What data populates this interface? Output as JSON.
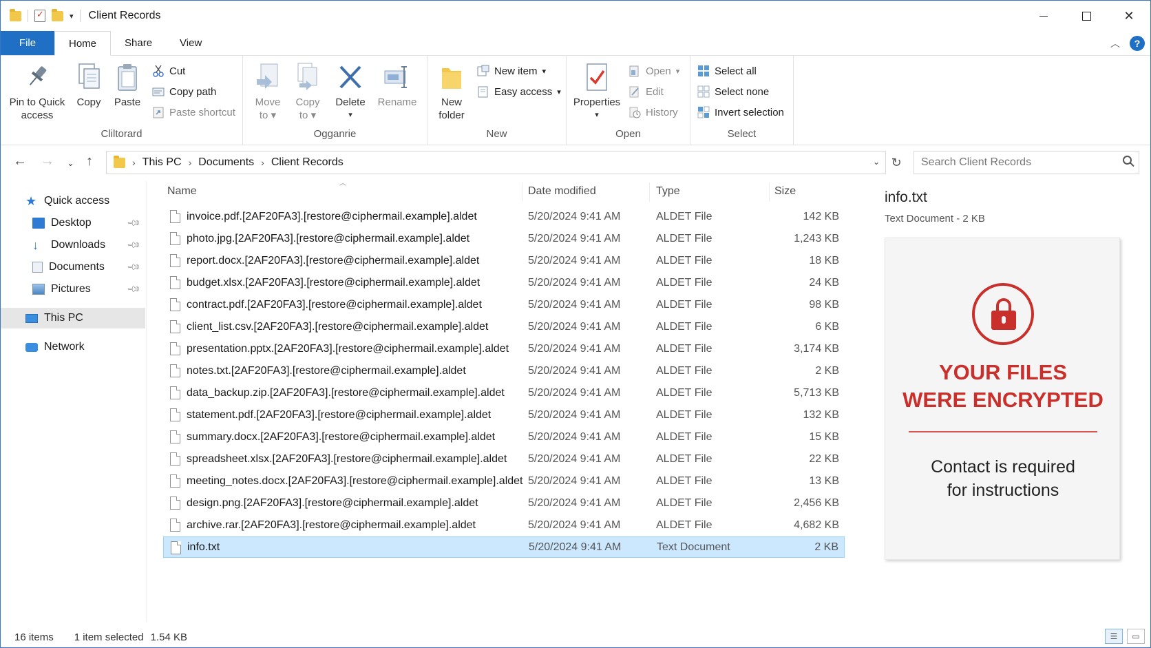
{
  "window": {
    "title": "Client Records",
    "controls": {
      "minimize": "minimize-icon",
      "maximize": "maximize-icon",
      "close": "✕"
    }
  },
  "tabs": [
    "File",
    "Home",
    "Share",
    "View"
  ],
  "ribbon": {
    "clipboard": {
      "label": "Cliltorard",
      "pin_line1": "Pin to Quick",
      "pin_line2": "access",
      "copy": "Copy",
      "paste": "Paste",
      "cut": "Cut",
      "copy_path": "Copy path",
      "paste_shortcut": "Paste shortcut"
    },
    "organize": {
      "label": "Ogganrie",
      "move_to_line1": "Move",
      "move_to_line2": "to",
      "copy_to_line1": "Copy",
      "copy_to_line2": "to",
      "delete": "Delete",
      "rename": "Rename"
    },
    "new": {
      "label": "New",
      "new_folder_line1": "New",
      "new_folder_line2": "folder",
      "new_item": "New item",
      "easy_access": "Easy access"
    },
    "open": {
      "label": "Open",
      "properties": "Properties",
      "open": "Open",
      "edit": "Edit",
      "history": "History"
    },
    "select": {
      "label": "Select",
      "select_all": "Select all",
      "select_none": "Select none",
      "invert_selection": "Invert selection"
    }
  },
  "address": {
    "crumbs": [
      "This PC",
      "Documents",
      "Client Records"
    ],
    "search_placeholder": "Search Client Records"
  },
  "navpane": {
    "quick_access": "Quick access",
    "items": [
      "Desktop",
      "Downloads",
      "Documents",
      "Pictures"
    ],
    "this_pc": "This PC",
    "network": "Network"
  },
  "columns": {
    "name": "Name",
    "date": "Date modified",
    "type": "Type",
    "size": "Size"
  },
  "files": [
    {
      "name": "invoice.pdf.[2AF20FA3].[restore@ciphermail.example].aldet",
      "date": "5/20/2024 9:41 AM",
      "type": "ALDET File",
      "size": "142 KB"
    },
    {
      "name": "photo.jpg.[2AF20FA3].[restore@ciphermail.example].aldet",
      "date": "5/20/2024 9:41 AM",
      "type": "ALDET File",
      "size": "1,243 KB"
    },
    {
      "name": "report.docx.[2AF20FA3].[restore@ciphermail.example].aldet",
      "date": "5/20/2024 9:41 AM",
      "type": "ALDET File",
      "size": "18 KB"
    },
    {
      "name": "budget.xlsx.[2AF20FA3].[restore@ciphermail.example].aldet",
      "date": "5/20/2024 9:41 AM",
      "type": "ALDET File",
      "size": "24 KB"
    },
    {
      "name": "contract.pdf.[2AF20FA3].[restore@ciphermail.example].aldet",
      "date": "5/20/2024 9:41 AM",
      "type": "ALDET File",
      "size": "98 KB"
    },
    {
      "name": "client_list.csv.[2AF20FA3].[restore@ciphermail.example].aldet",
      "date": "5/20/2024 9:41 AM",
      "type": "ALDET File",
      "size": "6 KB"
    },
    {
      "name": "presentation.pptx.[2AF20FA3].[restore@ciphermail.example].aldet",
      "date": "5/20/2024 9:41 AM",
      "type": "ALDET File",
      "size": "3,174 KB"
    },
    {
      "name": "notes.txt.[2AF20FA3].[restore@ciphermail.example].aldet",
      "date": "5/20/2024 9:41 AM",
      "type": "ALDET File",
      "size": "2 KB"
    },
    {
      "name": "data_backup.zip.[2AF20FA3].[restore@ciphermail.example].aldet",
      "date": "5/20/2024 9:41 AM",
      "type": "ALDET File",
      "size": "5,713 KB"
    },
    {
      "name": "statement.pdf.[2AF20FA3].[restore@ciphermail.example].aldet",
      "date": "5/20/2024 9:41 AM",
      "type": "ALDET File",
      "size": "132 KB"
    },
    {
      "name": "summary.docx.[2AF20FA3].[restore@ciphermail.example].aldet",
      "date": "5/20/2024 9:41 AM",
      "type": "ALDET File",
      "size": "15 KB"
    },
    {
      "name": "spreadsheet.xlsx.[2AF20FA3].[restore@ciphermail.example].aldet",
      "date": "5/20/2024 9:41 AM",
      "type": "ALDET File",
      "size": "22 KB"
    },
    {
      "name": "meeting_notes.docx.[2AF20FA3].[restore@ciphermail.example].aldet",
      "date": "5/20/2024 9:41 AM",
      "type": "ALDET File",
      "size": "13 KB"
    },
    {
      "name": "design.png.[2AF20FA3].[restore@ciphermail.example].aldet",
      "date": "5/20/2024 9:41 AM",
      "type": "ALDET File",
      "size": "2,456 KB"
    },
    {
      "name": "archive.rar.[2AF20FA3].[restore@ciphermail.example].aldet",
      "date": "5/20/2024 9:41 AM",
      "type": "ALDET File",
      "size": "4,682 KB"
    },
    {
      "name": "info.txt",
      "date": "5/20/2024 9:41 AM",
      "type": "Text Document",
      "size": "2 KB",
      "selected": true
    }
  ],
  "preview": {
    "title": "info.txt",
    "subtitle": "Text Document - 2 KB",
    "heading_line1": "YOUR FILES",
    "heading_line2": "WERE ENCRYPTED",
    "message_line1": "Contact is required",
    "message_line2": "for instructions",
    "accent_color": "#c9302c"
  },
  "status": {
    "count": "16 items",
    "selected": "1 item selected",
    "selected_size": "1.54 KB"
  },
  "colors": {
    "file_tab": "#1f6fc5",
    "selection": "#cce8ff"
  }
}
